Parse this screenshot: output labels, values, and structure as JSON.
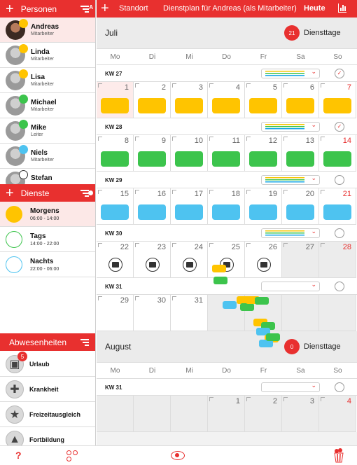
{
  "colors": {
    "accent": "#e8302f",
    "morning": "#ffc400",
    "day": "#3cc44c",
    "night": "#4ec3f0"
  },
  "persons_header": {
    "label": "Personen",
    "sort_label": "A"
  },
  "persons": [
    {
      "name": "Andreas",
      "role": "Mitarbeiter",
      "dot": "#ffc400",
      "selected": true
    },
    {
      "name": "Linda",
      "role": "Mitarbeiter",
      "dot": "#ffc400"
    },
    {
      "name": "Lisa",
      "role": "Mitarbeiter",
      "dot": "#ffc400"
    },
    {
      "name": "Michael",
      "role": "Mitarbeiter",
      "dot": "#3cc44c"
    },
    {
      "name": "Mike",
      "role": "Leiter",
      "dot": "#3cc44c"
    },
    {
      "name": "Niels",
      "role": "Mitarbeiter",
      "dot": "#4ec3f0"
    },
    {
      "name": "Stefan",
      "role": "",
      "dot": "#333333"
    }
  ],
  "shifts_header": {
    "label": "Dienste"
  },
  "shifts": [
    {
      "name": "Morgens",
      "time": "06:00 - 14:00",
      "color": "#ffc400",
      "filled": true,
      "selected": true
    },
    {
      "name": "Tags",
      "time": "14:00 - 22:00",
      "color": "#3cc44c",
      "filled": false
    },
    {
      "name": "Nachts",
      "time": "22:00 - 06:00",
      "color": "#4ec3f0",
      "filled": false
    }
  ],
  "absences_header": {
    "label": "Abwesenheiten"
  },
  "absences": [
    {
      "name": "Urlaub",
      "icon": "suitcase-icon",
      "glyph": "▣",
      "badge": "5"
    },
    {
      "name": "Krankheit",
      "icon": "cross-icon",
      "glyph": "✚"
    },
    {
      "name": "Freizeitausgleich",
      "icon": "star-icon",
      "glyph": "★"
    },
    {
      "name": "Fortbildung",
      "icon": "graduation-cap-icon",
      "glyph": "▲"
    }
  ],
  "topbar": {
    "location": "Standort",
    "title": "Dienstplan für Andreas (als Mitarbeiter)",
    "today": "Heute"
  },
  "weekdays": [
    "Mo",
    "Di",
    "Mi",
    "Do",
    "Fr",
    "Sa",
    "So"
  ],
  "months": [
    {
      "name": "Juli",
      "badge": "21",
      "badge_label": "Diensttage",
      "weeks": [
        {
          "kw": "KW 27",
          "checked": true,
          "stripes": true,
          "days": [
            {
              "n": "1",
              "shift": "morning",
              "pink": true
            },
            {
              "n": "2",
              "shift": "morning"
            },
            {
              "n": "3",
              "shift": "morning"
            },
            {
              "n": "4",
              "shift": "morning"
            },
            {
              "n": "5",
              "shift": "morning"
            },
            {
              "n": "6",
              "shift": "morning"
            },
            {
              "n": "7",
              "shift": "morning",
              "sun": true
            }
          ]
        },
        {
          "kw": "KW 28",
          "checked": true,
          "stripes": true,
          "days": [
            {
              "n": "8",
              "shift": "day"
            },
            {
              "n": "9",
              "shift": "day"
            },
            {
              "n": "10",
              "shift": "day"
            },
            {
              "n": "11",
              "shift": "day"
            },
            {
              "n": "12",
              "shift": "day"
            },
            {
              "n": "13",
              "shift": "day"
            },
            {
              "n": "14",
              "shift": "day",
              "sun": true
            }
          ]
        },
        {
          "kw": "KW 29",
          "checked": false,
          "stripes": true,
          "days": [
            {
              "n": "15",
              "shift": "night"
            },
            {
              "n": "16",
              "shift": "night"
            },
            {
              "n": "17",
              "shift": "night"
            },
            {
              "n": "18",
              "shift": "night"
            },
            {
              "n": "19",
              "shift": "night"
            },
            {
              "n": "20",
              "shift": "night"
            },
            {
              "n": "21",
              "shift": "night",
              "sun": true
            }
          ]
        },
        {
          "kw": "KW 30",
          "checked": false,
          "stripes": true,
          "days": [
            {
              "n": "22",
              "vac": true
            },
            {
              "n": "23",
              "vac": true
            },
            {
              "n": "24",
              "vac": true
            },
            {
              "n": "25",
              "vac": true
            },
            {
              "n": "26",
              "vac": true
            },
            {
              "n": "27",
              "grey": true
            },
            {
              "n": "28",
              "sun": true,
              "grey": true
            }
          ]
        },
        {
          "kw": "KW 31",
          "checked": false,
          "stripes": false,
          "days": [
            {
              "n": "29"
            },
            {
              "n": "30"
            },
            {
              "n": "31"
            },
            {
              "n": "",
              "grey": true
            },
            {
              "n": "",
              "grey": true
            },
            {
              "n": "",
              "grey": true
            },
            {
              "n": "",
              "grey": true
            }
          ]
        }
      ]
    },
    {
      "name": "August",
      "badge": "0",
      "badge_label": "Diensttage",
      "weeks": [
        {
          "kw": "KW 31",
          "checked": false,
          "stripes": false,
          "days": [
            {
              "n": "",
              "grey": true
            },
            {
              "n": "",
              "grey": true
            },
            {
              "n": "",
              "grey": true
            },
            {
              "n": "1",
              "grey": true
            },
            {
              "n": "2",
              "grey": true
            },
            {
              "n": "3",
              "grey": true
            },
            {
              "n": "4",
              "sun": true,
              "grey": true
            }
          ]
        }
      ]
    }
  ],
  "bottom": {
    "help": "?"
  }
}
